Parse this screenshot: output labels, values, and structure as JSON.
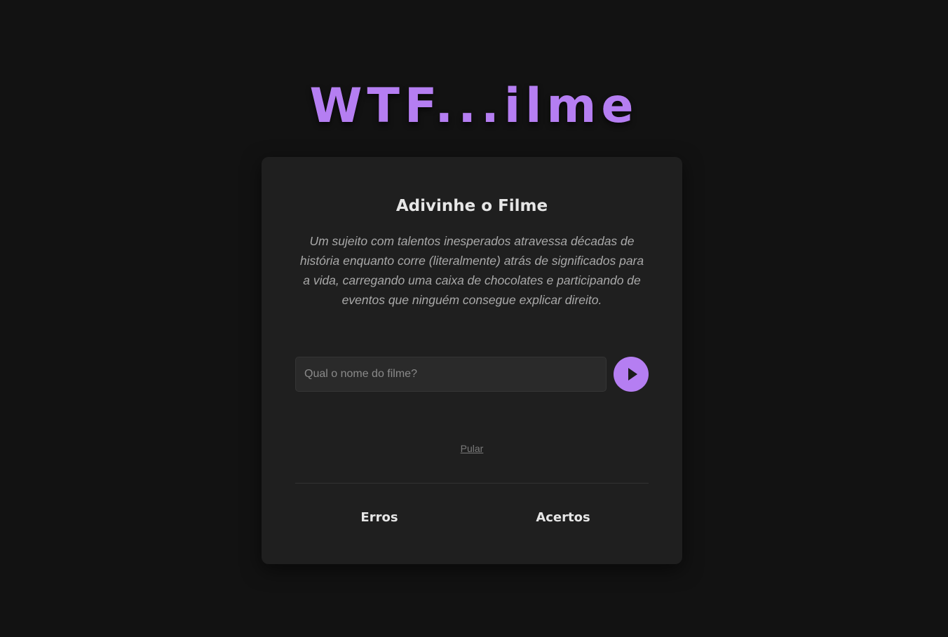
{
  "app": {
    "logo_text": "WTF...ilme",
    "accent_color": "#b57ef2"
  },
  "card": {
    "title": "Adivinhe o Filme",
    "description": "Um sujeito com talentos inesperados atravessa décadas de história enquanto corre (literalmente) atrás de significados para a vida, carregando uma caixa de chocolates e participando de eventos que ninguém consegue explicar direito.",
    "guess_input": {
      "placeholder": "Qual o nome do filme?",
      "value": ""
    },
    "submit_icon": "play-icon",
    "skip_label": "Pular"
  },
  "stats": {
    "errors_label": "Erros",
    "hits_label": "Acertos"
  }
}
